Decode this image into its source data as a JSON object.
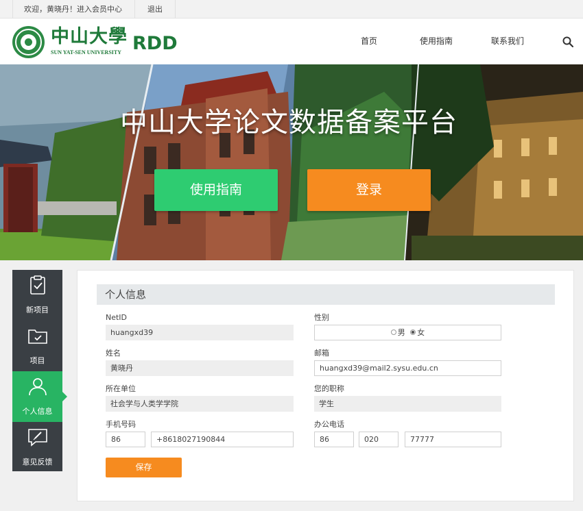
{
  "topbar": {
    "welcome": "欢迎，黄晓丹！进入会员中心",
    "logout": "退出"
  },
  "header": {
    "logo_cn": "中山大學",
    "logo_en": "SUN YAT-SEN UNIVERSITY",
    "logo_abbr": "RDD",
    "nav": [
      "首页",
      "使用指南",
      "联系我们"
    ],
    "search_icon": "search-icon"
  },
  "banner": {
    "title": "中山大学论文数据备案平台",
    "guide_button": "使用指南",
    "login_button": "登录"
  },
  "sidebar": {
    "items": [
      {
        "label": "新项目",
        "icon": "clipboard-check-icon"
      },
      {
        "label": "项目",
        "icon": "folder-check-icon"
      },
      {
        "label": "个人信息",
        "icon": "user-icon",
        "active": true
      },
      {
        "label": "意见反馈",
        "icon": "pen-feedback-icon"
      }
    ]
  },
  "panel": {
    "title": "个人信息",
    "netid_label": "NetID",
    "netid": "huangxd39",
    "gender_label": "性别",
    "gender_male": "男",
    "gender_female": "女",
    "gender_selected": "女",
    "name_label": "姓名",
    "name": "黄晓丹",
    "email_label": "邮箱",
    "email": "huangxd39@mail2.sysu.edu.cn",
    "unit_label": "所在单位",
    "unit": "社会学与人类学学院",
    "title_label": "您的职称",
    "job_title": "学生",
    "mobile_label": "手机号码",
    "mobile_country": "86",
    "mobile_number": "+8618027190844",
    "office_label": "办公电话",
    "office_country": "86",
    "office_area": "020",
    "office_number": "77777",
    "save_button": "保存"
  },
  "colors": {
    "brand_green": "#1f7a3a",
    "guide_green": "#2ecc71",
    "accent_orange": "#f68b1f",
    "sidebar_dark": "#3a3f44",
    "sidebar_active": "#28b463"
  }
}
